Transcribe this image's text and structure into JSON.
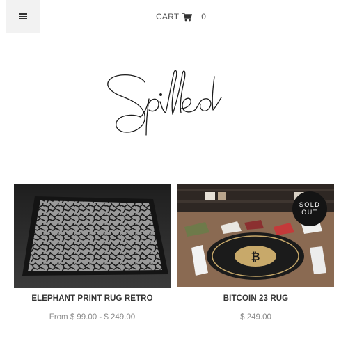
{
  "header": {
    "menu_icon": "hamburger-icon",
    "cart": {
      "label": "CART",
      "icon": "shopping-cart-icon",
      "count": "0"
    }
  },
  "logo": {
    "text": "Spilled"
  },
  "products": [
    {
      "title": "ELEPHANT PRINT RUG RETRO",
      "price": "From $ 99.00 - $ 249.00",
      "image": "elephant print rug"
    },
    {
      "title": "BITCOIN 23 RUG",
      "price": "$ 249.00",
      "badge_line1": "SOLD",
      "badge_line2": "OUT",
      "image": "bitcoin rug with sneakers"
    }
  ],
  "colors": {
    "badge_bg": "#141414",
    "menu_bg": "#f2f2f2",
    "price_text": "#8a8a8a"
  }
}
